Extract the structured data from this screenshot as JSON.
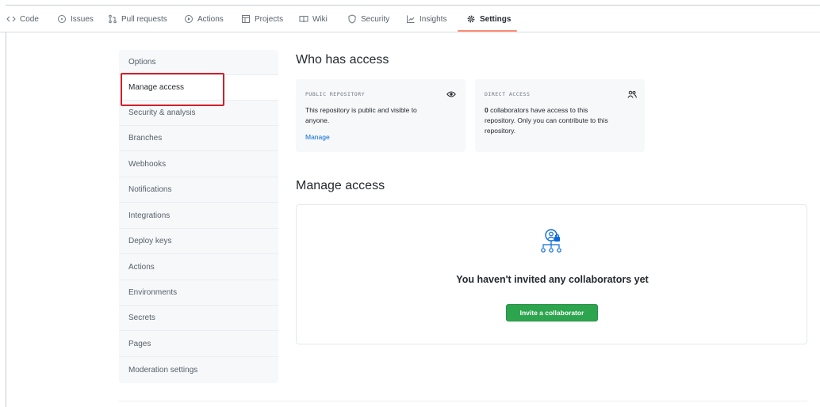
{
  "nav": {
    "items": [
      {
        "label": "Code",
        "icon": "code-icon"
      },
      {
        "label": "Issues",
        "icon": "issue-icon"
      },
      {
        "label": "Pull requests",
        "icon": "pull-request-icon"
      },
      {
        "label": "Actions",
        "icon": "play-icon"
      },
      {
        "label": "Projects",
        "icon": "table-icon"
      },
      {
        "label": "Wiki",
        "icon": "book-icon"
      },
      {
        "label": "Security",
        "icon": "shield-icon"
      },
      {
        "label": "Insights",
        "icon": "graph-icon"
      },
      {
        "label": "Settings",
        "icon": "gear-icon"
      }
    ],
    "selected": "Settings",
    "underline_color": "#fd8c73"
  },
  "sidebar": {
    "items": [
      {
        "label": "Options"
      },
      {
        "label": "Manage access"
      },
      {
        "label": "Security & analysis"
      },
      {
        "label": "Branches"
      },
      {
        "label": "Webhooks"
      },
      {
        "label": "Notifications"
      },
      {
        "label": "Integrations"
      },
      {
        "label": "Deploy keys"
      },
      {
        "label": "Actions"
      },
      {
        "label": "Environments"
      },
      {
        "label": "Secrets"
      },
      {
        "label": "Pages"
      },
      {
        "label": "Moderation settings"
      }
    ],
    "active": "Manage access",
    "highlight_color": "#d0202a"
  },
  "who_has_access": {
    "title": "Who has access",
    "public_card": {
      "label": "PUBLIC REPOSITORY",
      "icon": "eye-icon",
      "text_line1": "This repository is public and visible to",
      "text_line2": "anyone.",
      "link": "Manage"
    },
    "direct_card": {
      "label": "DIRECT ACCESS",
      "icon": "people-icon",
      "count": "0",
      "text_line1_rest": " collaborators have access to this",
      "text_line2": "repository. Only you can contribute to this",
      "text_line3": "repository."
    }
  },
  "manage_access": {
    "title": "Manage access",
    "empty_icon": "collaborators-lock-icon",
    "empty_title": "You haven't invited any collaborators yet",
    "invite_button": "Invite a collaborator",
    "button_color": "#2da44e"
  }
}
